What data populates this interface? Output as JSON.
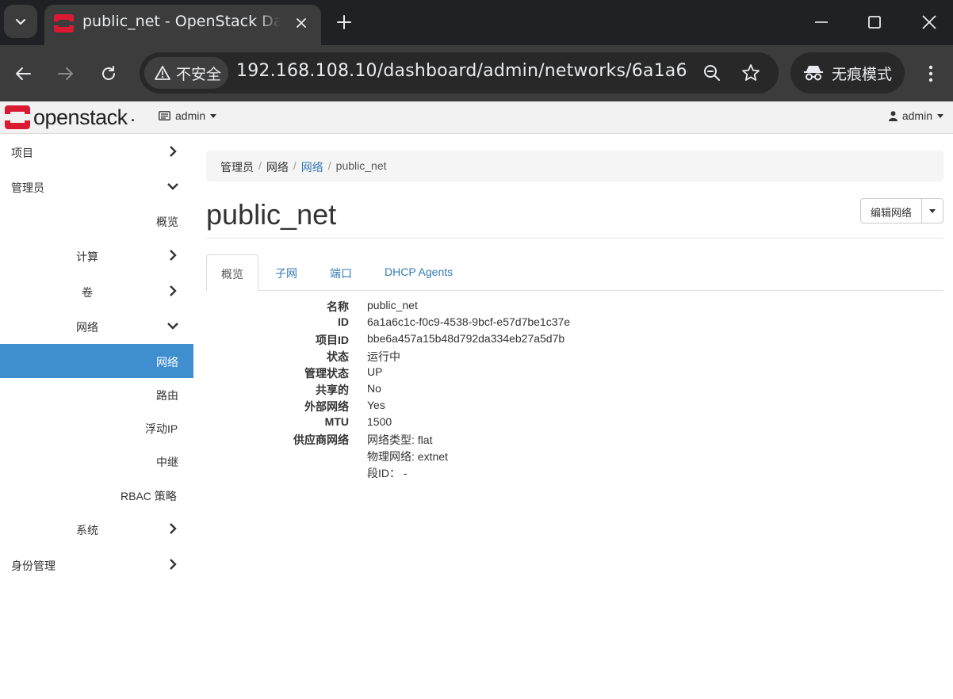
{
  "browser": {
    "tab_title": "public_net - OpenStack Dashboard",
    "security_label": "不安全",
    "url": "192.168.108.10/dashboard/admin/networks/6a1a6c1c-...",
    "incognito_label": "无痕模式"
  },
  "app": {
    "brand": "openstack",
    "project_picker": "admin",
    "user_menu": "admin"
  },
  "sidebar": {
    "items": [
      {
        "label": "项目"
      },
      {
        "label": "管理员"
      },
      {
        "label": "概览"
      },
      {
        "label": "计算"
      },
      {
        "label": "卷"
      },
      {
        "label": "网络"
      },
      {
        "label": "网络"
      },
      {
        "label": "路由"
      },
      {
        "label": "浮动IP"
      },
      {
        "label": "中继"
      },
      {
        "label": "RBAC 策略"
      },
      {
        "label": "系统"
      },
      {
        "label": "身份管理"
      }
    ]
  },
  "breadcrumb": [
    "管理员",
    "网络",
    "网络",
    "public_net"
  ],
  "page": {
    "title": "public_net",
    "edit_button": "编辑网络"
  },
  "tabs": [
    "概览",
    "子网",
    "端口",
    "DHCP Agents"
  ],
  "overview": {
    "rows": [
      {
        "label": "名称",
        "value": "public_net"
      },
      {
        "label": "ID",
        "value": "6a1a6c1c-f0c9-4538-9bcf-e57d7be1c37e"
      },
      {
        "label": "项目ID",
        "value": "bbe6a457a15b48d792da334eb27a5d7b"
      },
      {
        "label": "状态",
        "value": "运行中"
      },
      {
        "label": "管理状态",
        "value": "UP"
      },
      {
        "label": "共享的",
        "value": "No"
      },
      {
        "label": "外部网络",
        "value": "Yes"
      },
      {
        "label": "MTU",
        "value": "1500"
      },
      {
        "label": "供应商网络",
        "value": "网络类型: flat"
      }
    ],
    "provider_extra": [
      "物理网络: extnet",
      "段ID： -"
    ]
  },
  "colors": {
    "accent": "#3f8ed0",
    "link": "#337ab7",
    "brand_red": "#da1a32"
  }
}
